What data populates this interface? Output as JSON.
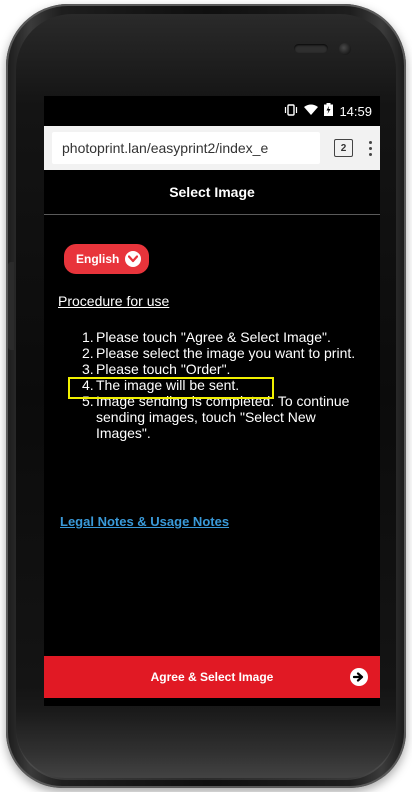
{
  "status_bar": {
    "time": "14:59"
  },
  "browser": {
    "url": "photoprint.lan/easyprint2/index_e",
    "tab_count": "2"
  },
  "page": {
    "title": "Select Image",
    "language_label": "English",
    "procedure_heading": "Procedure for use",
    "steps": [
      {
        "num": "1.",
        "text": "Please touch \"Agree & Select Image\"."
      },
      {
        "num": "2.",
        "text": "Please select the image you want to print."
      },
      {
        "num": "3.",
        "text": "Please touch \"Order\"."
      },
      {
        "num": "4.",
        "text": "The image will be sent."
      },
      {
        "num": "5.",
        "text": "Image sending is completed. To continue sending images, touch \"Select New Images\"."
      }
    ],
    "legal_link": "Legal Notes & Usage Notes",
    "agree_button": "Agree & Select Image"
  },
  "colors": {
    "accent_red": "#e11924",
    "language_red": "#e8343b",
    "link_blue": "#3a9ad9",
    "highlight_yellow": "#f0f000"
  },
  "icons": {
    "status": [
      "vibrate-icon",
      "wifi-icon",
      "battery-icon"
    ],
    "language": "chevron-down-icon",
    "agree": "arrow-right-circle-icon"
  }
}
